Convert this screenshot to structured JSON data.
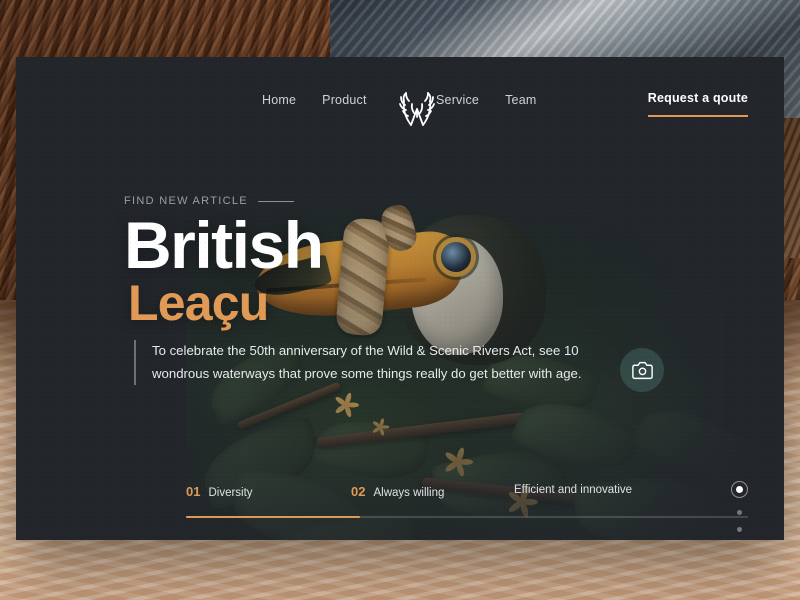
{
  "nav": {
    "links_left": [
      {
        "label": "Home"
      },
      {
        "label": "Product"
      }
    ],
    "links_right": [
      {
        "label": "Service"
      },
      {
        "label": "Team"
      }
    ],
    "logo_name": "antler-w-logo",
    "cta_label": "Request a qoute"
  },
  "hero": {
    "eyebrow": "FIND NEW ARTICLE",
    "title_line1": "British",
    "title_line2": "Leaçu",
    "body": "To celebrate the 50th anniversary of the Wild & Scenic Rivers Act, see 10 wondrous waterways that prove some things really do get better with age.",
    "camera_button_name": "camera-icon"
  },
  "social": [
    {
      "name": "twitter-icon"
    },
    {
      "name": "youtube-icon"
    }
  ],
  "pagination": {
    "active_index": 0,
    "total": 4
  },
  "bottom_nav": {
    "items": [
      {
        "number": "01",
        "label": "Diversity"
      },
      {
        "number": "02",
        "label": "Always willing"
      },
      {
        "number": "",
        "label": "Efficient and innovative"
      }
    ],
    "progress_percent": 31
  },
  "colors": {
    "accent": "#e09a56",
    "card_bg": "#22262b",
    "text_primary": "#ffffff",
    "text_muted": "#9b9fa3"
  }
}
